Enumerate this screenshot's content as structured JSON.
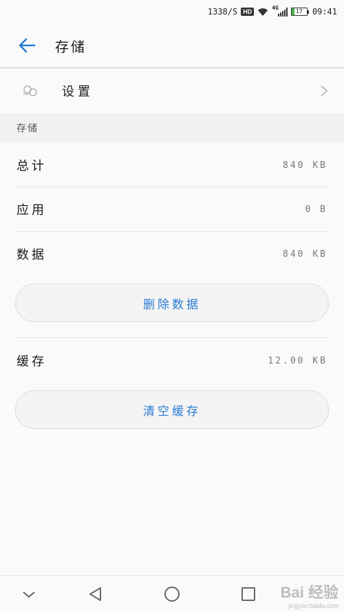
{
  "status_bar": {
    "speed": "1338/S",
    "hd": "HD",
    "network": "4G",
    "battery": "17",
    "time": "09:41"
  },
  "app_bar": {
    "title": "存储",
    "back_icon": "arrow-left-icon"
  },
  "settings_row": {
    "label": "设置",
    "icon": "clouds-icon",
    "chevron": "chevron-right-icon"
  },
  "section_title": "存储",
  "storage": {
    "total": {
      "label": "总计",
      "value": "840 KB"
    },
    "app": {
      "label": "应用",
      "value": "0 B"
    },
    "data": {
      "label": "数据",
      "value": "840 KB"
    },
    "delete_button": "删除数据",
    "cache": {
      "label": "缓存",
      "value": "12.00 KB"
    },
    "clear_button": "清空缓存"
  },
  "watermark": {
    "brand": "Bai 经验",
    "url": "jingyan.baidu.com"
  },
  "colors": {
    "accent": "#2a7bd3",
    "background": "#fafafa",
    "section": "#f1f1f1"
  }
}
